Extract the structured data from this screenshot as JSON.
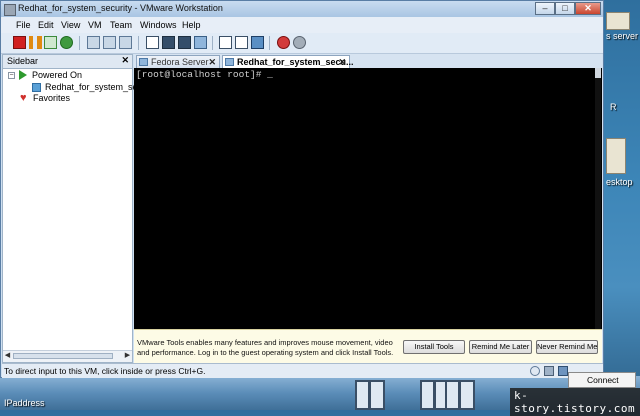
{
  "window": {
    "title": "Redhat_for_system_security - VMware Workstation"
  },
  "menu": [
    "File",
    "Edit",
    "View",
    "VM",
    "Team",
    "Windows",
    "Help"
  ],
  "sidebar": {
    "title": "Sidebar",
    "groups": [
      {
        "label": "Powered On",
        "items": [
          "Redhat_for_system_security"
        ]
      }
    ],
    "favorites": "Favorites"
  },
  "tabs": [
    {
      "label": "Fedora Server",
      "active": false
    },
    {
      "label": "Redhat_for_system_secu...",
      "active": true
    }
  ],
  "console": {
    "text": "[root@localhost root]# _"
  },
  "notification": {
    "text": "VMware Tools enables many features and improves mouse movement, video and performance. Log in to the guest operating system and click Install Tools.",
    "buttons": [
      "Install Tools",
      "Remind Me Later",
      "Never Remind Me"
    ]
  },
  "status": {
    "text": "To direct input to this VM, click inside or press Ctrl+G."
  },
  "desktop": {
    "labels": [
      "s server",
      "R",
      "esktop",
      "IPaddress"
    ],
    "popup": "Connect",
    "watermark": "k-story.tistory.com"
  },
  "colors": {
    "console_bg": "#000000",
    "notify_bg": "#fdfbe6",
    "accent": "#5a7ea5"
  }
}
